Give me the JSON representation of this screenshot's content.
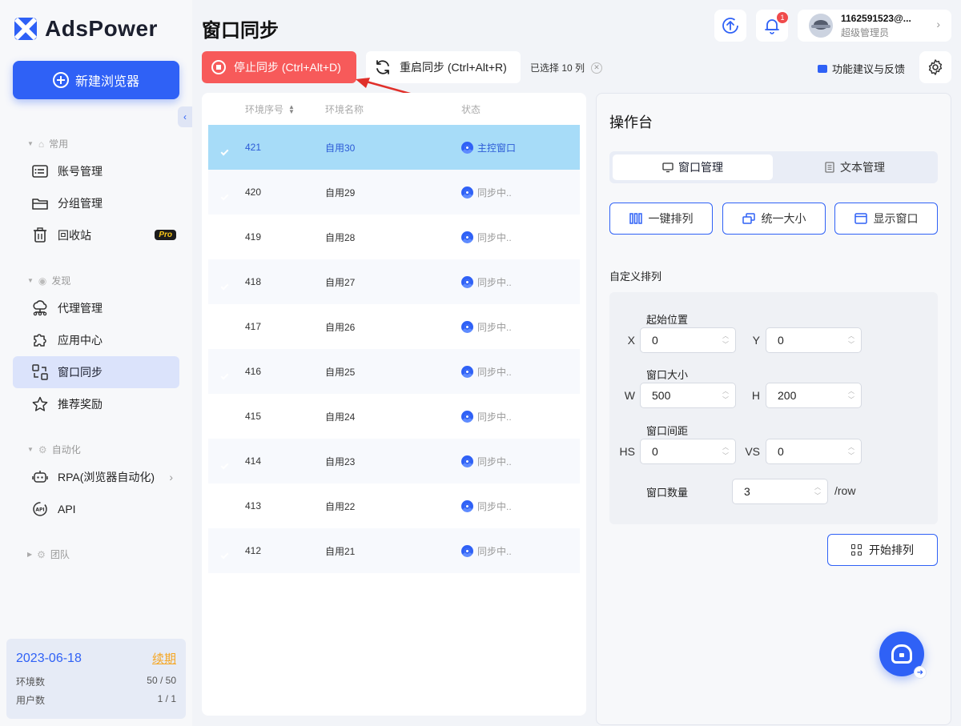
{
  "app": {
    "logo_text": "AdsPower",
    "new_browser_label": "新建浏览器"
  },
  "sidebar": {
    "sections": [
      {
        "label": "常用"
      },
      {
        "label": "发现"
      },
      {
        "label": "自动化"
      },
      {
        "label": "团队"
      }
    ],
    "items": [
      {
        "label": "账号管理",
        "icon": "account-list-icon"
      },
      {
        "label": "分组管理",
        "icon": "folder-icon"
      },
      {
        "label": "回收站",
        "icon": "trash-icon",
        "badge": "Pro"
      },
      {
        "label": "代理管理",
        "icon": "proxy-cloud-icon"
      },
      {
        "label": "应用中心",
        "icon": "puzzle-icon"
      },
      {
        "label": "窗口同步",
        "icon": "window-sync-icon",
        "active": true
      },
      {
        "label": "推荐奖励",
        "icon": "star-icon"
      },
      {
        "label": "RPA(浏览器自动化)",
        "icon": "robot-icon"
      },
      {
        "label": "API",
        "icon": "api-icon"
      }
    ],
    "license": {
      "date": "2023-06-18",
      "renew_label": "续期",
      "env_label": "环境数",
      "env_value": "50 / 50",
      "user_label": "用户数",
      "user_value": "1 / 1"
    }
  },
  "header": {
    "title": "窗口同步",
    "notification_count": "1",
    "user_name": "1162591523@...",
    "user_role": "超级管理员"
  },
  "toolbar": {
    "stop_label": "停止同步 (Ctrl+Alt+D)",
    "restart_label": "重启同步 (Ctrl+Alt+R)",
    "selected_label": "已选择 10 列",
    "feedback_label": "功能建议与反馈"
  },
  "table": {
    "columns": [
      "环境序号",
      "环境名称",
      "状态"
    ],
    "rows": [
      {
        "id": "421",
        "name": "自用30",
        "status": "主控窗口"
      },
      {
        "id": "420",
        "name": "自用29",
        "status": "同步中.."
      },
      {
        "id": "419",
        "name": "自用28",
        "status": "同步中.."
      },
      {
        "id": "418",
        "name": "自用27",
        "status": "同步中.."
      },
      {
        "id": "417",
        "name": "自用26",
        "status": "同步中.."
      },
      {
        "id": "416",
        "name": "自用25",
        "status": "同步中.."
      },
      {
        "id": "415",
        "name": "自用24",
        "status": "同步中.."
      },
      {
        "id": "414",
        "name": "自用23",
        "status": "同步中.."
      },
      {
        "id": "413",
        "name": "自用22",
        "status": "同步中.."
      },
      {
        "id": "412",
        "name": "自用21",
        "status": "同步中.."
      }
    ]
  },
  "console": {
    "title": "操作台",
    "tabs": [
      {
        "label": "窗口管理",
        "active": true
      },
      {
        "label": "文本管理",
        "active": false
      }
    ],
    "actions": [
      {
        "label": "一键排列"
      },
      {
        "label": "统一大小"
      },
      {
        "label": "显示窗口"
      }
    ],
    "custom_label": "自定义排列",
    "start_position_label": "起始位置",
    "window_size_label": "窗口大小",
    "window_gap_label": "窗口间距",
    "window_count_label": "窗口数量",
    "fields": {
      "x_label": "X",
      "x_value": "0",
      "y_label": "Y",
      "y_value": "0",
      "w_label": "W",
      "w_value": "500",
      "h_label": "H",
      "h_value": "200",
      "hs_label": "HS",
      "hs_value": "0",
      "vs_label": "VS",
      "vs_value": "0",
      "count_value": "3",
      "count_unit": "/row"
    },
    "start_label": "开始排列"
  },
  "colors": {
    "accent": "#2f61f6",
    "stop": "#f75a5a",
    "master_row": "#a7dcf8",
    "renew": "#f5a623"
  }
}
